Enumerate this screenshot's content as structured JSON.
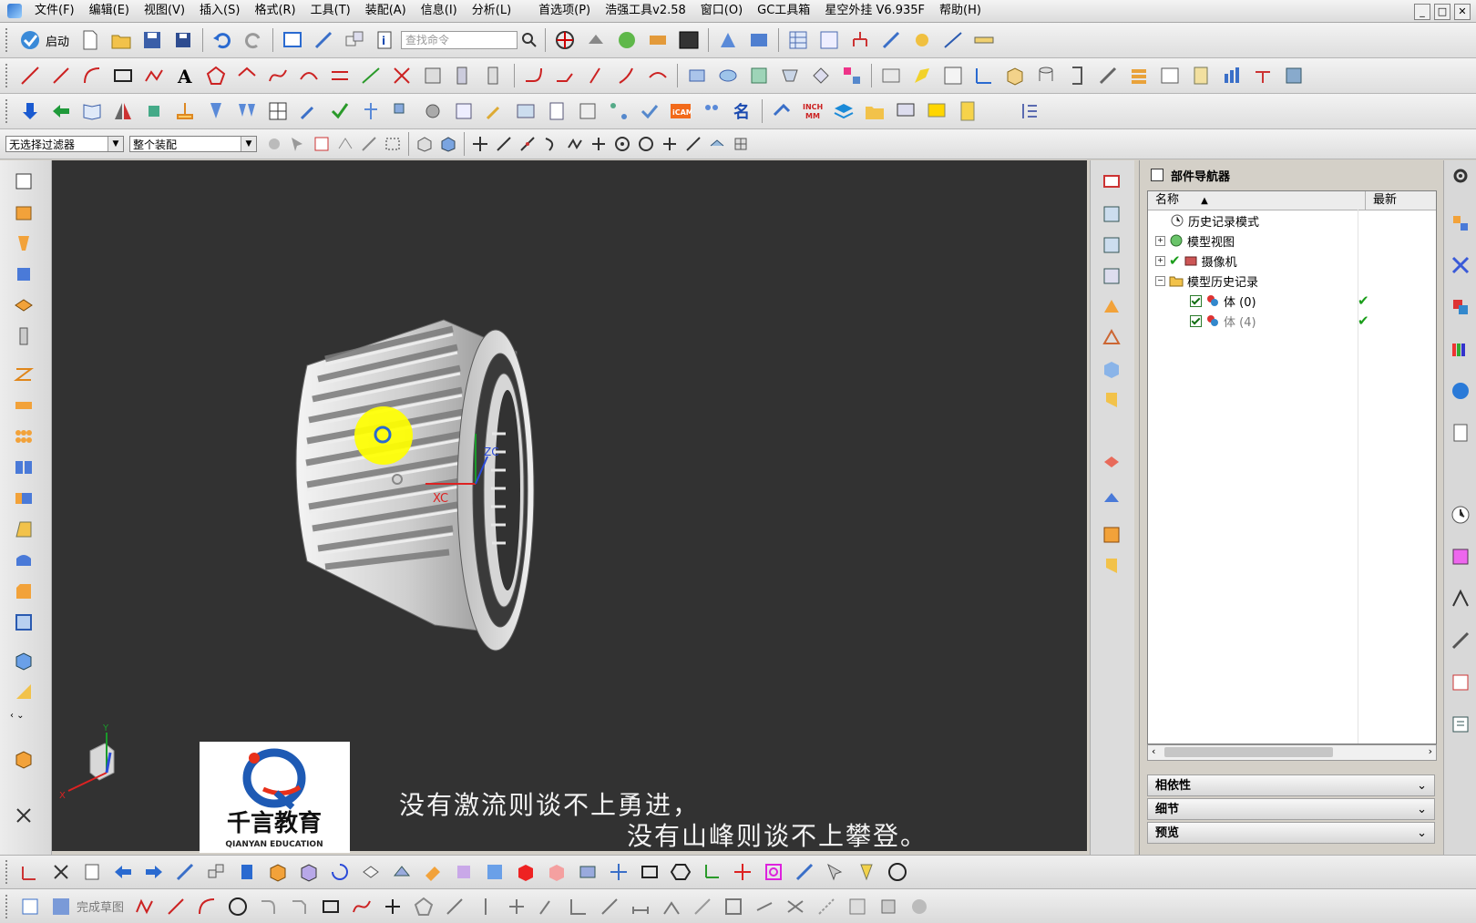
{
  "menubar": {
    "items": [
      "文件(F)",
      "编辑(E)",
      "视图(V)",
      "插入(S)",
      "格式(R)",
      "工具(T)",
      "装配(A)",
      "信息(I)",
      "分析(L)",
      "首选项(P)",
      "浩强工具v2.58",
      "窗口(O)",
      "GC工具箱",
      "星空外挂 V6.935F",
      "帮助(H)"
    ],
    "window_controls": [
      "_",
      "□",
      "✕"
    ]
  },
  "toolbar1": {
    "start_label": "启动",
    "search_placeholder": "查找命令"
  },
  "toolbar4": {
    "filter_value": "无选择过滤器",
    "scope_value": "整个装配"
  },
  "navigator": {
    "title": "部件导航器",
    "col_name": "名称",
    "col_latest": "最新",
    "rows": [
      {
        "label": "历史记录模式"
      },
      {
        "label": "模型视图"
      },
      {
        "label": "摄像机"
      },
      {
        "label": "模型历史记录"
      },
      {
        "label": "体 (0)"
      },
      {
        "label": "体 (4)"
      }
    ],
    "panels": [
      "相依性",
      "细节",
      "预览"
    ]
  },
  "viewport": {
    "axis_x": "XC",
    "axis_z": "ZC",
    "triad_x": "X",
    "triad_y": "Y"
  },
  "bottom": {
    "finish_sketch": "完成草图"
  },
  "overlay": {
    "logo_cn": "千言教育",
    "logo_en": "QIANYAN EDUCATION",
    "subtitle_line1": "没有激流则谈不上勇进，",
    "subtitle_line2": "没有山峰则谈不上攀登。"
  },
  "colors": {
    "viewport_bg": "#323232",
    "highlight": "#ffff00",
    "check_green": "#1a9d1a"
  }
}
